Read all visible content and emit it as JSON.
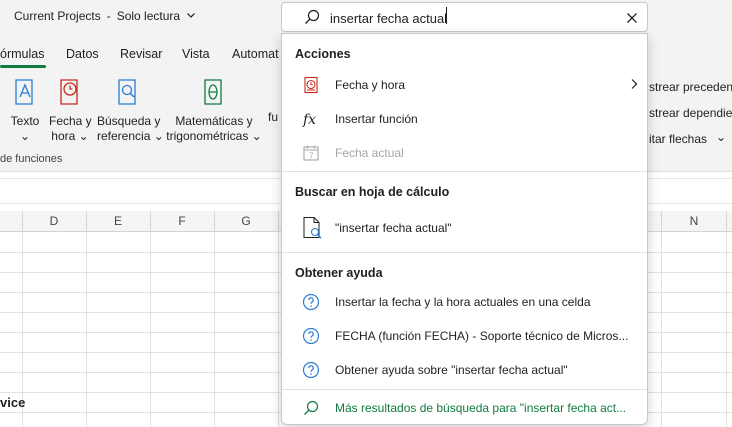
{
  "window": {
    "doc_title": "Current Projects",
    "separator": "-",
    "mode": "Solo lectura"
  },
  "tabs": [
    "órmulas",
    "Datos",
    "Revisar",
    "Vista",
    "Automat"
  ],
  "ribbon": {
    "buttons": [
      {
        "line1": "Texto",
        "line2": "⌄",
        "icon": "text-icon",
        "color": "#2b7cd3"
      },
      {
        "line1": "Fecha y",
        "line2": "hora ⌄",
        "icon": "date-time-icon",
        "color": "#c42b1c"
      },
      {
        "line1": "Búsqueda y",
        "line2": "referencia ⌄",
        "icon": "lookup-icon",
        "color": "#2b7cd3"
      },
      {
        "line1": "Matemáticas y",
        "line2": "trigonométricas ⌄",
        "icon": "math-icon",
        "color": "#107c41"
      },
      {
        "line1": "",
        "line2": "fu",
        "icon": "",
        "color": ""
      }
    ],
    "group_label": "de funciones",
    "right_items": [
      "strear precedent",
      "strear dependier",
      "itar flechas",
      "⌄"
    ]
  },
  "columns": [
    "D",
    "E",
    "F",
    "G",
    "N"
  ],
  "cell_text": "vice",
  "search": {
    "value": "insertar fecha actual",
    "placeholder": ""
  },
  "dropdown": {
    "sections": [
      {
        "title": "Acciones"
      },
      {
        "title": "Buscar en hoja de cálculo"
      },
      {
        "title": "Obtener ayuda"
      }
    ],
    "actions": [
      {
        "label": "Fecha y hora",
        "icon": "calendar-clock-icon",
        "enabled": true,
        "has_submenu": true
      },
      {
        "label": "Insertar función",
        "icon": "function-icon",
        "enabled": true,
        "has_submenu": false
      },
      {
        "label": "Fecha actual",
        "icon": "calendar-icon",
        "enabled": false,
        "has_submenu": false
      }
    ],
    "sheet_search": {
      "label": "\"insertar fecha actual\"",
      "icon": "document-search-icon"
    },
    "help": [
      {
        "label": "Insertar la fecha y la hora actuales en una celda",
        "icon": "help-icon"
      },
      {
        "label": "FECHA (función FECHA) - Soporte técnico de Micros...",
        "icon": "help-icon"
      },
      {
        "label": "Obtener ayuda sobre \"insertar fecha actual\"",
        "icon": "help-icon"
      }
    ],
    "more": {
      "label": "Más resultados de búsqueda para \"insertar fecha act...",
      "icon": "search-icon"
    }
  },
  "colors": {
    "accent": "#107c41",
    "help_blue": "#2b7cd3",
    "disabled": "#a6a6a6"
  }
}
